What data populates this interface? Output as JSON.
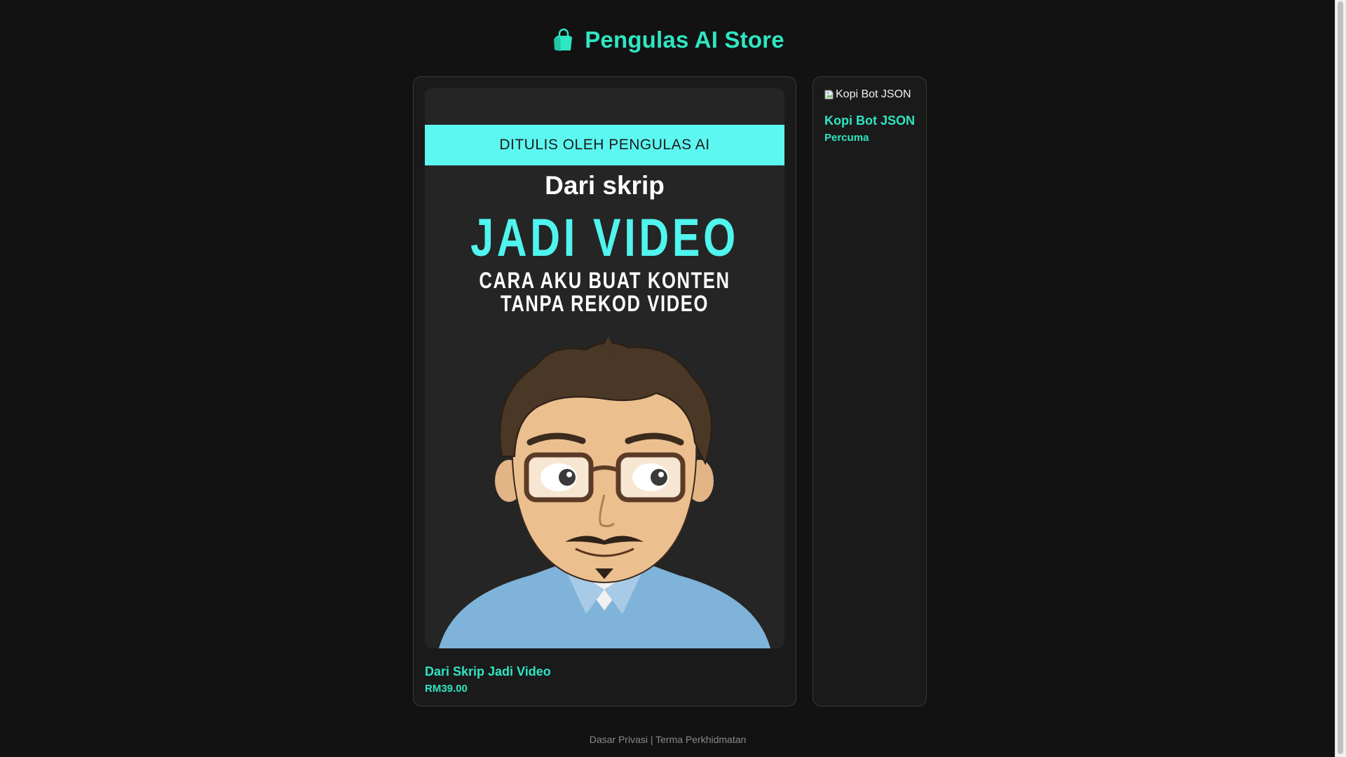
{
  "header": {
    "store_name": "Pengulas AI Store",
    "icon": "shopping-bag-icon"
  },
  "colors": {
    "accent": "#2ee6c2",
    "background": "#121212",
    "card": "#1a1a1a",
    "banner": "#5cf7f0"
  },
  "products": [
    {
      "cover": {
        "banner": "DITULIS OLEH PENGULAS AI",
        "line1": "Dari skrip",
        "line2": "JADI VIDEO",
        "line3": "CARA AKU BUAT KONTEN TANPA REKOD VIDEO"
      },
      "title": "Dari Skrip Jadi Video",
      "price": "RM39.00"
    },
    {
      "image_alt": "Kopi Bot JSON",
      "title": "Kopi Bot JSON",
      "price": "Percuma"
    }
  ],
  "footer": {
    "privacy": "Dasar Privasi",
    "separator": "|",
    "terms": "Terma Perkhidmatan"
  }
}
